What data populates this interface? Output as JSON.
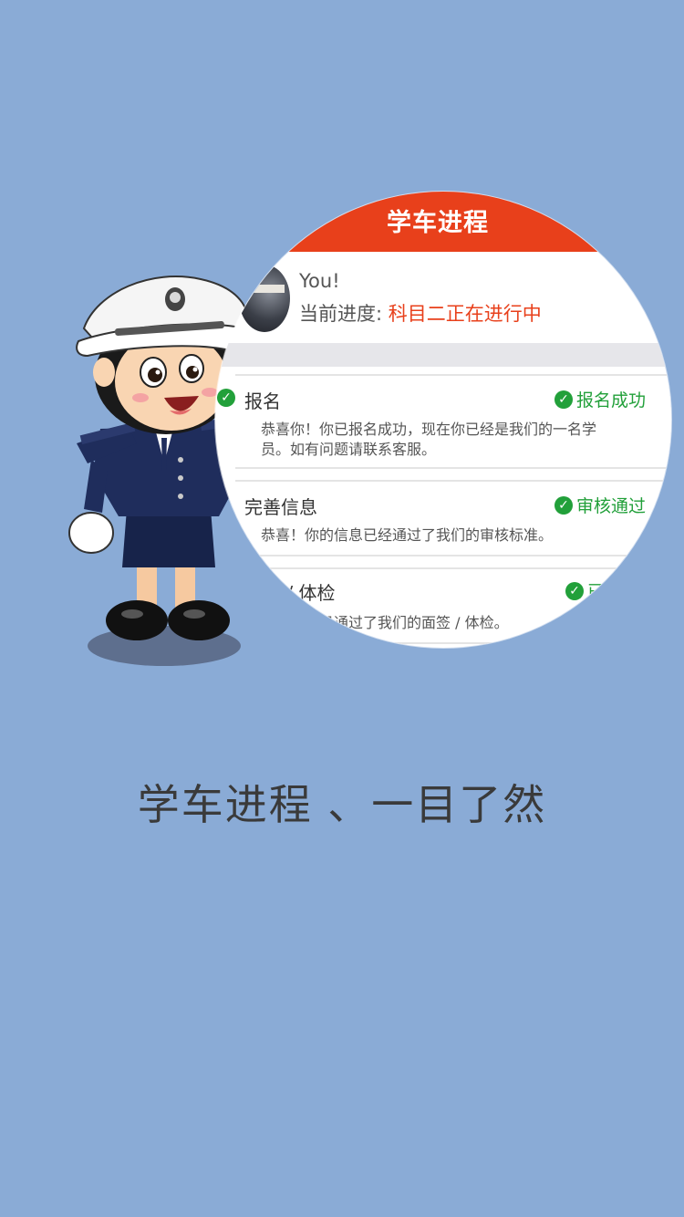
{
  "screen": {
    "background": "#8aabd6",
    "accent": "#e8401b",
    "success": "#22a03a"
  },
  "magnifier": {
    "title": "学车进程",
    "user_name": "You!",
    "progress_label": "当前进度: ",
    "progress_value": "科目二正在进行中",
    "steps": [
      {
        "title": "报名",
        "status": "报名成功",
        "desc_lines": [
          "恭喜你！你已报名成功，现在你已经是我们的一名学",
          "员。如有问题请联系客服。"
        ]
      },
      {
        "title": "完善信息",
        "status": "审核通过",
        "desc_lines": [
          "恭喜！你的信息已经通过了我们的审核标准。"
        ]
      },
      {
        "title": "面签 / 体检",
        "status": "已通过",
        "desc_lines": [
          "恭喜！你已通过了我们的面签 / 体检。"
        ]
      }
    ]
  },
  "tagline": "学车进程 、一目了然"
}
